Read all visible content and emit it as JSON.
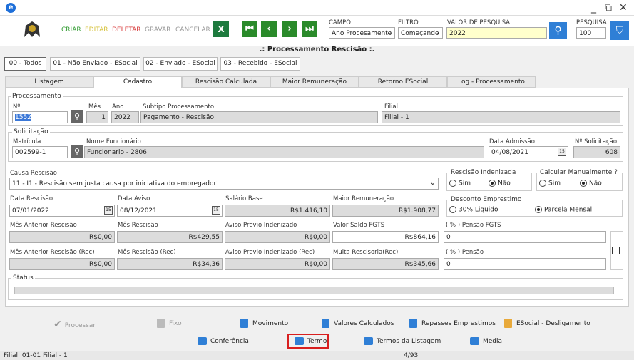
{
  "toolbar": {
    "criar": "CRIAR",
    "editar": "EDITAR",
    "deletar": "DELETAR",
    "gravar": "GRAVAR",
    "cancelar": "CANCELAR",
    "campo_label": "CAMPO",
    "campo_value": "Ano Procesamento",
    "filtro_label": "FILTRO",
    "filtro_value": "Começando",
    "valor_label": "VALOR DE PESQUISA",
    "valor_value": "2022",
    "pesquisa_label": "PESQUISA",
    "pesquisa_value": "100",
    "colors": {
      "criar": "#2e9a2e",
      "editar": "#d6c23a",
      "deletar": "#d83a3a",
      "disabled": "#999999",
      "nav": "#2a8a2a"
    }
  },
  "page_title": ".: Processamento Rescisão :.",
  "tabs": [
    "00 - Todos",
    "01 - Não Enviado - ESocial",
    "02 - Enviado - ESocial",
    "03 - Recebido - ESocial"
  ],
  "subtabs": [
    "Listagem",
    "Cadastro",
    "Rescisão Calculada",
    "Maior Remuneração",
    "Retorno ESocial",
    "Log - Processamento"
  ],
  "processamento": {
    "group": "Processamento",
    "n_label": "Nº",
    "n_value": "1552",
    "mes_label": "Mês",
    "mes_value": "1",
    "ano_label": "Ano",
    "ano_value": "2022",
    "subtipo_label": "Subtipo Processamento",
    "subtipo_value": "Pagamento - Rescisão",
    "filial_label": "Filial",
    "filial_value": "Filial - 1"
  },
  "solicitacao": {
    "group": "Solicitação",
    "matricula_label": "Matrícula",
    "matricula_value": "002599-1",
    "nome_label": "Nome Funcionário",
    "nome_value": "Funcionario - 2806",
    "admissao_label": "Data Admissão",
    "admissao_value": "04/08/2021",
    "nsol_label": "Nº Solicitação",
    "nsol_value": "608"
  },
  "causa": {
    "label": "Causa Rescisão",
    "value": "11 - I1 - Rescisão sem justa causa por iniciativa do empregador"
  },
  "indenizada": {
    "label": "Rescisão Indenizada",
    "sim": "Sim",
    "nao": "Não"
  },
  "calcular": {
    "label": "Calcular Manualmente ?",
    "sim": "Sim",
    "nao": "Não"
  },
  "desconto": {
    "label": "Desconto Emprestimo",
    "opt1": "30% Liquido",
    "opt2": "Parcela Mensal"
  },
  "row1": {
    "data_rescisao_label": "Data Rescisão",
    "data_rescisao": "07/01/2022",
    "data_aviso_label": "Data Aviso",
    "data_aviso": "08/12/2021",
    "salario_label": "Salário Base",
    "salario": "R$1.416,10",
    "maior_label": "Maior Remuneração",
    "maior": "R$1.908,77"
  },
  "row2": {
    "mes_ant_label": "Mês Anterior Rescisão",
    "mes_ant": "R$0,00",
    "mes_resc_label": "Mês Rescisão",
    "mes_resc": "R$429,55",
    "aviso_label": "Aviso Previo Indenizado",
    "aviso": "R$0,00",
    "fgts_label": "Valor Saldo FGTS",
    "fgts": "R$864,16",
    "pfgts_label": "( % ) Pensão FGTS",
    "pfgts": "0"
  },
  "row3": {
    "mes_ant_label": "Mês Anterior Rescisão (Rec)",
    "mes_ant": "R$0,00",
    "mes_resc_label": "Mês Rescisão (Rec)",
    "mes_resc": "R$34,36",
    "aviso_label": "Aviso Previo Indenizado (Rec)",
    "aviso": "R$0,00",
    "multa_label": "Multa Rescisoria(Rec)",
    "multa": "R$345,66",
    "pensao_label": "( % ) Pensão",
    "pensao": "0"
  },
  "status_label": "Status",
  "buttons": {
    "processar": "Processar",
    "fixo": "Fixo",
    "movimento": "Movimento",
    "valores": "Valores Calculados",
    "repasses": "Repasses Emprestimos",
    "esocial": "ESocial - Desligamento",
    "conferencia": "Conferência",
    "termo": "Termo",
    "termos_listagem": "Termos da Listagem",
    "media": "Media"
  },
  "statusbar": {
    "left": "Filial: 01-01 Filial - 1",
    "page": "4/93"
  }
}
